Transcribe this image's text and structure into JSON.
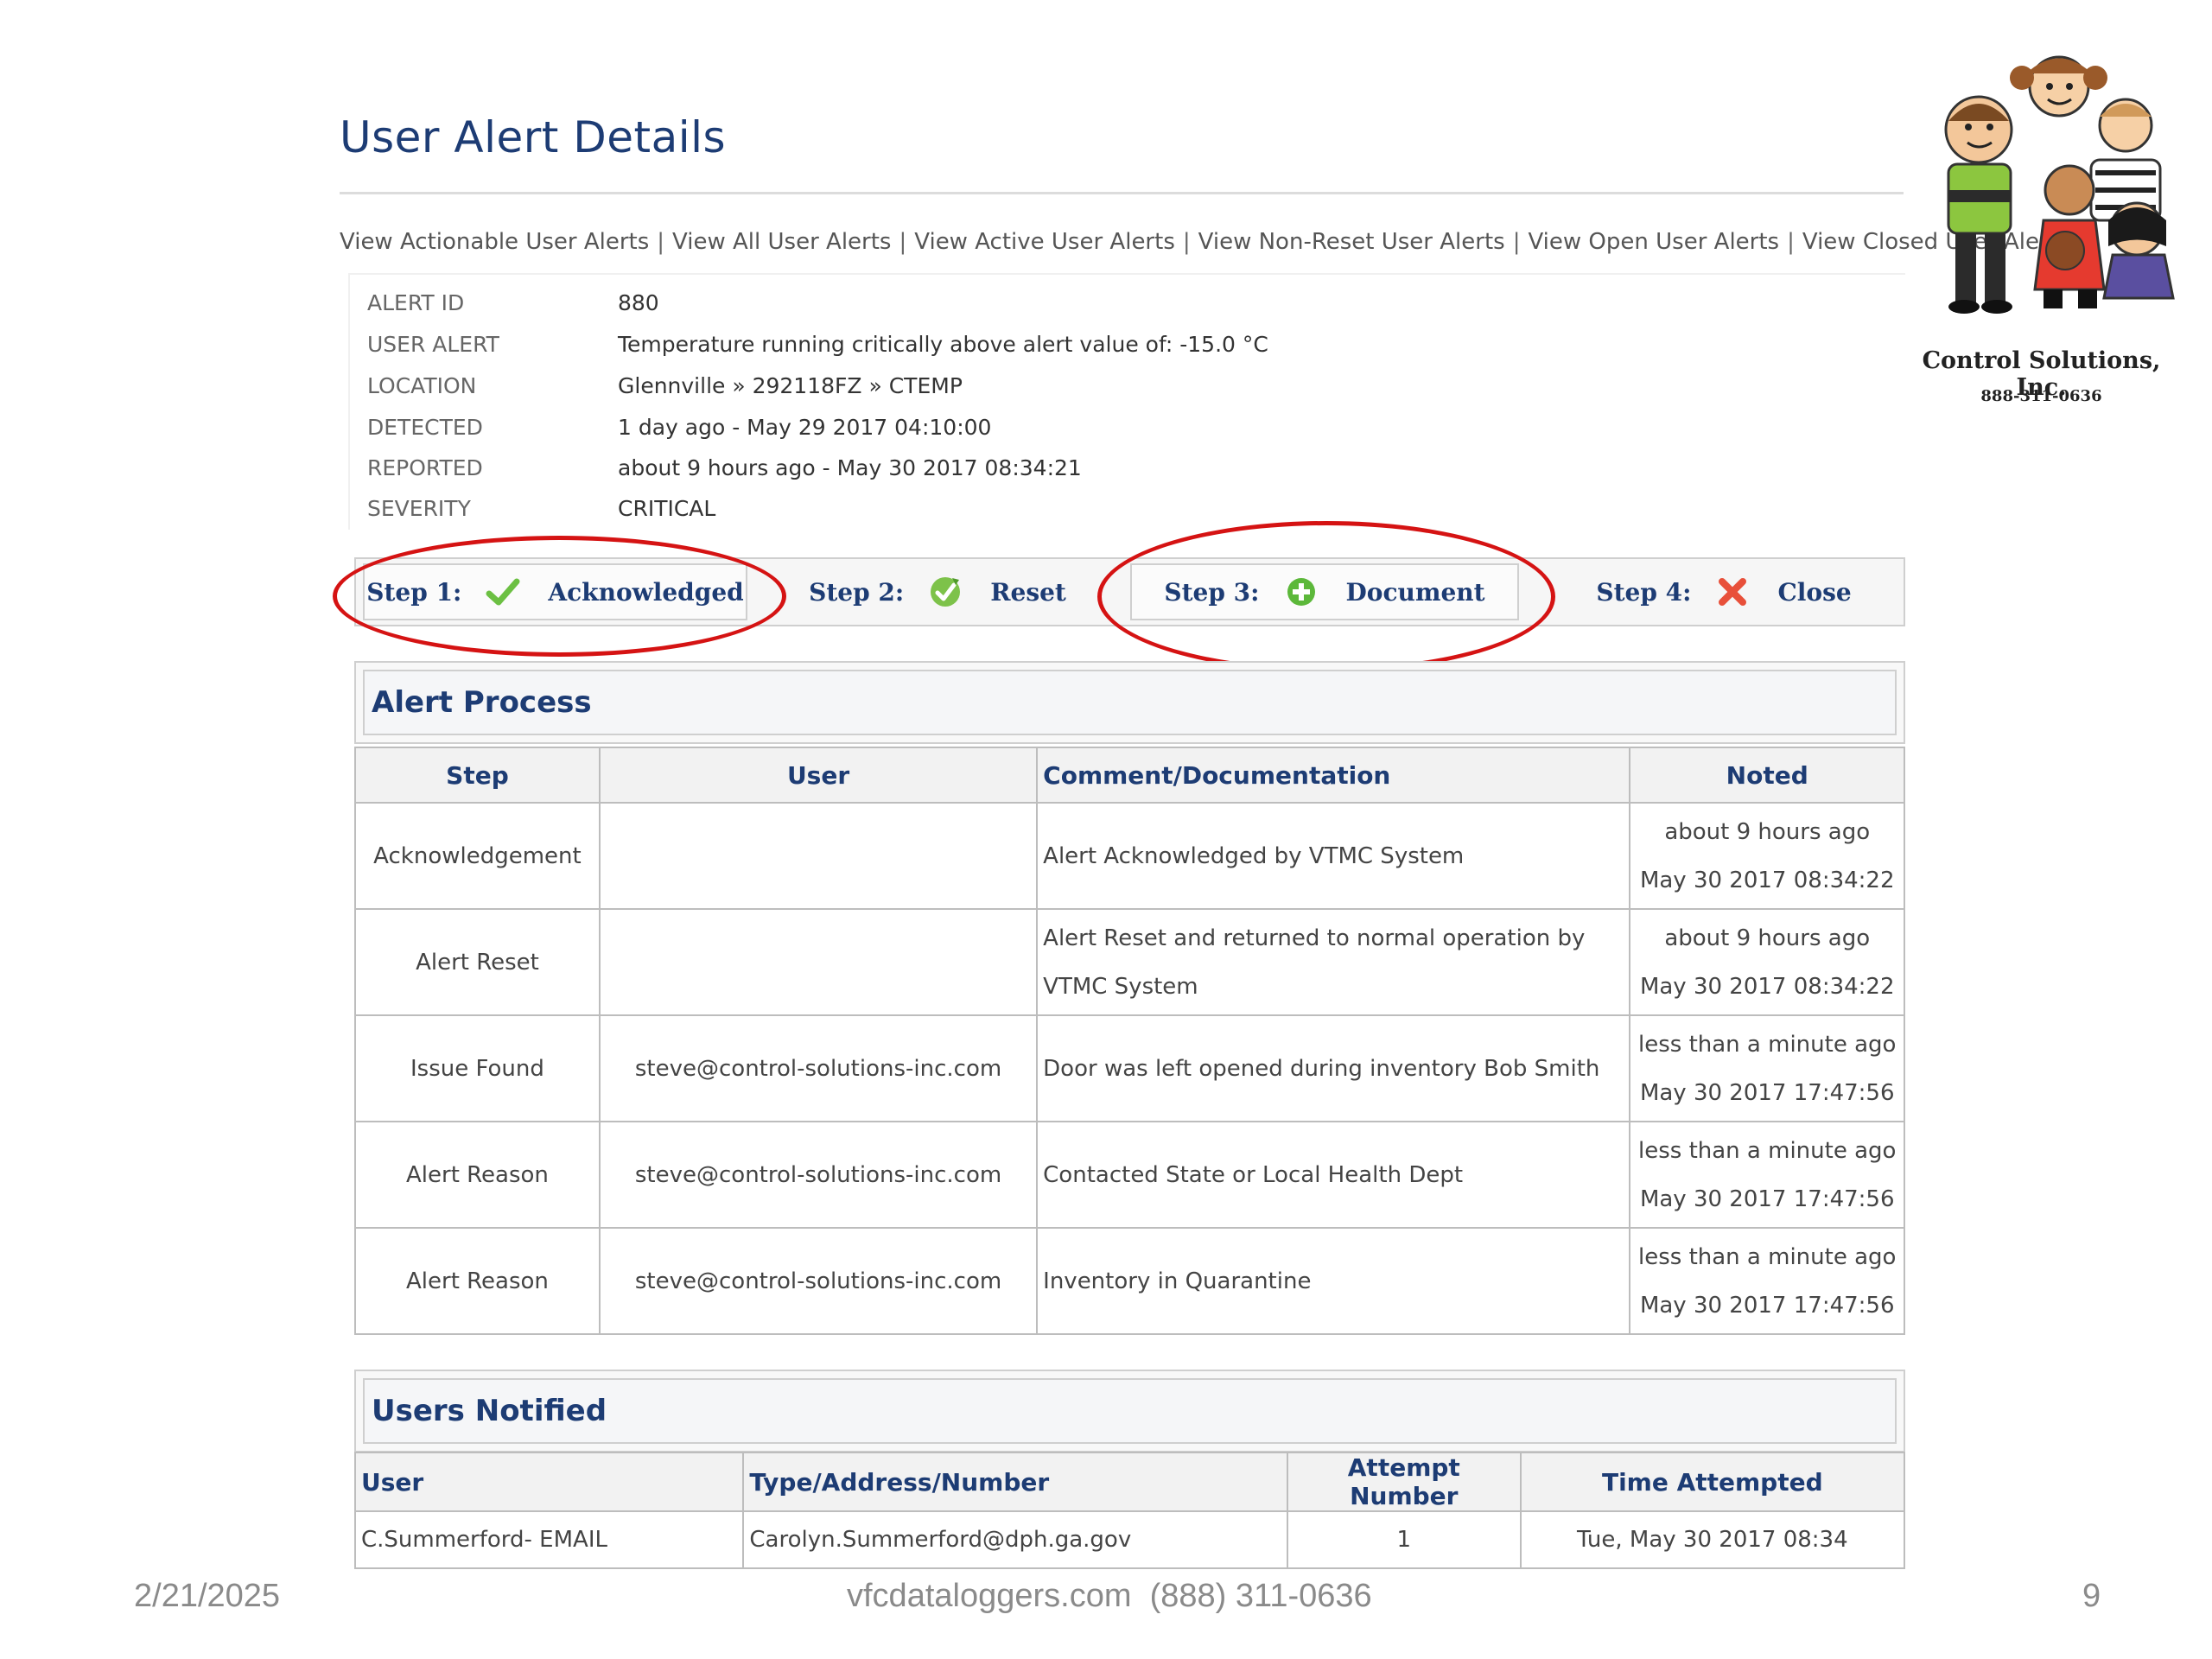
{
  "page": {
    "title": "User Alert Details"
  },
  "nav": {
    "links": [
      "View Actionable User Alerts",
      "View All User Alerts",
      "View Active User Alerts",
      "View Non-Reset User Alerts",
      "View Open User Alerts",
      "View Closed User Alerts"
    ],
    "separator": "|"
  },
  "details": [
    {
      "label": "ALERT ID",
      "value": "880"
    },
    {
      "label": "USER ALERT",
      "value": "Temperature running critically above alert value of: -15.0 °C"
    },
    {
      "label": "LOCATION",
      "value": "Glennville » 292118FZ » CTEMP"
    },
    {
      "label": "DETECTED",
      "value": "1 day ago - May 29 2017 04:10:00"
    },
    {
      "label": "REPORTED",
      "value": "about 9 hours ago - May 30 2017 08:34:21"
    },
    {
      "label": "SEVERITY",
      "value": "CRITICAL"
    }
  ],
  "steps": [
    {
      "num": "Step 1:",
      "label": "Acknowledged",
      "icon": "checkmark-icon"
    },
    {
      "num": "Step 2:",
      "label": "Reset",
      "icon": "reset-icon"
    },
    {
      "num": "Step 3:",
      "label": "Document",
      "icon": "plus-circle-icon"
    },
    {
      "num": "Step 4:",
      "label": "Close",
      "icon": "close-x-icon"
    }
  ],
  "alert_process": {
    "title": "Alert Process",
    "columns": [
      "Step",
      "User",
      "Comment/Documentation",
      "Noted"
    ],
    "rows": [
      {
        "step": "Acknowledgement",
        "user": "",
        "comment": "Alert Acknowledged by VTMC System",
        "noted_rel": "about 9 hours ago",
        "noted_date": "May 30 2017 08:34:22"
      },
      {
        "step": "Alert Reset",
        "user": "",
        "comment": "Alert Reset and returned to normal operation by VTMC System",
        "noted_rel": "about 9 hours ago",
        "noted_date": "May 30 2017 08:34:22"
      },
      {
        "step": "Issue Found",
        "user": "steve@control-solutions-inc.com",
        "comment": "Door was left opened during inventory Bob Smith",
        "noted_rel": "less than a minute ago",
        "noted_date": "May 30 2017 17:47:56"
      },
      {
        "step": "Alert Reason",
        "user": "steve@control-solutions-inc.com",
        "comment": "Contacted State or Local Health Dept",
        "noted_rel": "less than a minute ago",
        "noted_date": "May 30 2017 17:47:56"
      },
      {
        "step": "Alert Reason",
        "user": "steve@control-solutions-inc.com",
        "comment": "Inventory in Quarantine",
        "noted_rel": "less than a minute ago",
        "noted_date": "May 30 2017 17:47:56"
      }
    ]
  },
  "users_notified": {
    "title": "Users Notified",
    "columns": [
      "User",
      "Type/Address/Number",
      "Attempt Number",
      "Time Attempted"
    ],
    "rows": [
      {
        "user": "C.Summerford- EMAIL",
        "address": "Carolyn.Summerford@dph.ga.gov",
        "attempt": "1",
        "time": "Tue, May 30 2017 08:34"
      }
    ]
  },
  "logo": {
    "company": "Control Solutions, Inc.",
    "phone": "888-311-0636"
  },
  "footer": {
    "date": "2/21/2025",
    "center": "vfcdataloggers.com  (888) 311-0636",
    "page_number": "9"
  },
  "colors": {
    "title": "#1d3c74",
    "highlight": "#d51313",
    "check": "#6cc043",
    "close": "#e8503a"
  }
}
